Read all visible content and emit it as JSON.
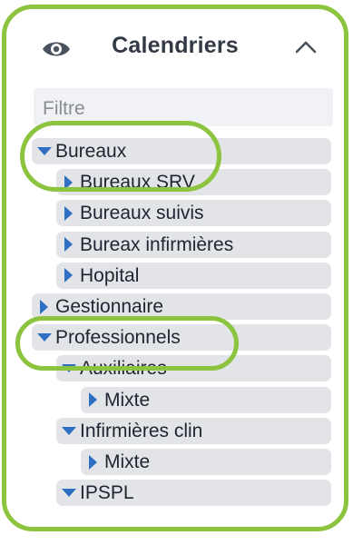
{
  "panel": {
    "title": "Calendriers",
    "eye_icon": "eye-icon",
    "collapse_icon": "chevron-up-icon"
  },
  "filter": {
    "placeholder": "Filtre",
    "value": ""
  },
  "tree": [
    {
      "label": "Bureaux",
      "level": 0,
      "expanded": true
    },
    {
      "label": "Bureaux SRV",
      "level": 1,
      "expanded": false
    },
    {
      "label": "Bureaux suivis",
      "level": 1,
      "expanded": false
    },
    {
      "label": "Bureax infirmières",
      "level": 1,
      "expanded": false
    },
    {
      "label": "Hopital",
      "level": 1,
      "expanded": false
    },
    {
      "label": "Gestionnaire",
      "level": 0,
      "expanded": false
    },
    {
      "label": "Professionnels",
      "level": 0,
      "expanded": true
    },
    {
      "label": "Auxiliaires",
      "level": 1,
      "expanded": true
    },
    {
      "label": "Mixte",
      "level": 2,
      "expanded": false
    },
    {
      "label": "Infirmières clin",
      "level": 1,
      "expanded": true
    },
    {
      "label": "Mixte",
      "level": 2,
      "expanded": false
    },
    {
      "label": "IPSPL",
      "level": 1,
      "expanded": true
    }
  ],
  "colors": {
    "accent_highlight": "#8cc43f",
    "expander": "#2f6fc4",
    "row_bg": "#e2e4e8",
    "title": "#333a45"
  }
}
